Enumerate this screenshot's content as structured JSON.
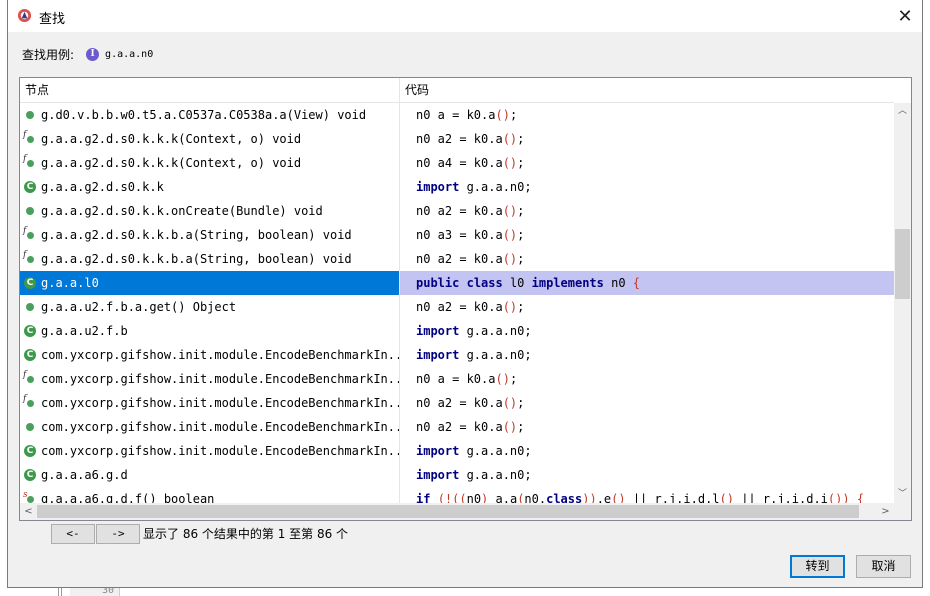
{
  "window": {
    "title": "查找",
    "close_symbol": "✕"
  },
  "search": {
    "label": "查找用例:",
    "badge": "I",
    "value": "g.a.a.n0"
  },
  "table": {
    "headers": {
      "node": "节点",
      "code": "代码"
    },
    "rows": [
      {
        "icon": "method-icon",
        "node": "g.d0.v.b.b.w0.t5.a.C0537a.C0538a.a(View) void",
        "code": [
          [
            "",
            "n0 a = k0.a"
          ],
          [
            "pr",
            "()"
          ],
          [
            "",
            ";"
          ]
        ]
      },
      {
        "icon": "subclass-method-icon",
        "node": "g.a.a.g2.d.s0.k.k.k(Context, o) void",
        "code": [
          [
            "",
            "n0 a2 = k0.a"
          ],
          [
            "pr",
            "()"
          ],
          [
            "",
            ";"
          ]
        ]
      },
      {
        "icon": "subclass-method-icon",
        "node": "g.a.a.g2.d.s0.k.k.k(Context, o) void",
        "code": [
          [
            "",
            "n0 a4 = k0.a"
          ],
          [
            "pr",
            "()"
          ],
          [
            "",
            ";"
          ]
        ]
      },
      {
        "icon": "class-icon",
        "node": "g.a.a.g2.d.s0.k.k",
        "code": [
          [
            "kw",
            "import"
          ],
          [
            "",
            " g.a.a.n0;"
          ]
        ]
      },
      {
        "icon": "method-icon",
        "node": "g.a.a.g2.d.s0.k.k.onCreate(Bundle) void",
        "code": [
          [
            "",
            "n0 a2 = k0.a"
          ],
          [
            "pr",
            "()"
          ],
          [
            "",
            ";"
          ]
        ]
      },
      {
        "icon": "subclass-method-icon",
        "node": "g.a.a.g2.d.s0.k.k.b.a(String, boolean) void",
        "code": [
          [
            "",
            "n0 a3 = k0.a"
          ],
          [
            "pr",
            "()"
          ],
          [
            "",
            ";"
          ]
        ]
      },
      {
        "icon": "subclass-method-icon",
        "node": "g.a.a.g2.d.s0.k.k.b.a(String, boolean) void",
        "code": [
          [
            "",
            "n0 a2 = k0.a"
          ],
          [
            "pr",
            "()"
          ],
          [
            "",
            ";"
          ]
        ]
      },
      {
        "icon": "class-icon",
        "node": "g.a.a.l0",
        "selected": true,
        "code": [
          [
            "kw",
            "public"
          ],
          [
            "",
            " "
          ],
          [
            "kw",
            "class"
          ],
          [
            "",
            " l0 "
          ],
          [
            "kw",
            "implements"
          ],
          [
            "",
            " n0 "
          ],
          [
            "pr",
            "{"
          ]
        ]
      },
      {
        "icon": "method-icon",
        "node": "g.a.a.u2.f.b.a.get() Object",
        "code": [
          [
            "",
            "n0 a2 = k0.a"
          ],
          [
            "pr",
            "()"
          ],
          [
            "",
            ";"
          ]
        ]
      },
      {
        "icon": "class-icon",
        "node": "g.a.a.u2.f.b",
        "code": [
          [
            "kw",
            "import"
          ],
          [
            "",
            " g.a.a.n0;"
          ]
        ]
      },
      {
        "icon": "class-icon",
        "node": "com.yxcorp.gifshow.init.module.EncodeBenchmarkIn...",
        "code": [
          [
            "kw",
            "import"
          ],
          [
            "",
            " g.a.a.n0;"
          ]
        ]
      },
      {
        "icon": "subclass-method-icon",
        "node": "com.yxcorp.gifshow.init.module.EncodeBenchmarkIn...",
        "code": [
          [
            "",
            "n0 a = k0.a"
          ],
          [
            "pr",
            "()"
          ],
          [
            "",
            ";"
          ]
        ]
      },
      {
        "icon": "subclass-method-icon",
        "node": "com.yxcorp.gifshow.init.module.EncodeBenchmarkIn...",
        "code": [
          [
            "",
            "n0 a2 = k0.a"
          ],
          [
            "pr",
            "()"
          ],
          [
            "",
            ";"
          ]
        ]
      },
      {
        "icon": "method-icon",
        "node": "com.yxcorp.gifshow.init.module.EncodeBenchmarkIn...",
        "code": [
          [
            "",
            "n0 a2 = k0.a"
          ],
          [
            "pr",
            "()"
          ],
          [
            "",
            ";"
          ]
        ]
      },
      {
        "icon": "class-icon",
        "node": "com.yxcorp.gifshow.init.module.EncodeBenchmarkIn...",
        "code": [
          [
            "kw",
            "import"
          ],
          [
            "",
            " g.a.a.n0;"
          ]
        ]
      },
      {
        "icon": "class-icon",
        "node": "g.a.a.a6.g.d",
        "code": [
          [
            "kw",
            "import"
          ],
          [
            "",
            " g.a.a.n0;"
          ]
        ]
      },
      {
        "icon": "synthetic-method-icon",
        "node": "g.a.a.a6.g.d.f() boolean",
        "code": [
          [
            "kw",
            "if"
          ],
          [
            "",
            " "
          ],
          [
            "pr",
            "(!(("
          ],
          [
            "",
            "n0"
          ],
          [
            "pr",
            ")"
          ],
          [
            "",
            " a.a"
          ],
          [
            "pr",
            "("
          ],
          [
            "",
            "n0."
          ],
          [
            "kw",
            "class"
          ],
          [
            "pr",
            "))"
          ],
          [
            "",
            ".e"
          ],
          [
            "pr",
            "()"
          ],
          [
            "",
            " || r.j.i.d.l"
          ],
          [
            "pr",
            "()"
          ],
          [
            "",
            " || r.j.i.d.i"
          ],
          [
            "pr",
            "())"
          ],
          [
            "",
            " "
          ],
          [
            "pr",
            "{"
          ]
        ]
      }
    ]
  },
  "scroll_glyphs": {
    "up": "︿",
    "down": "﹀",
    "left": "<",
    "right": ">"
  },
  "pager": {
    "prev_label": "<-",
    "next_label": "->",
    "info": "显示了 86 个结果中的第 1 至第 86 个"
  },
  "buttons": {
    "goto": "转到",
    "cancel": "取消"
  },
  "background": {
    "line_number": "30"
  },
  "colors": {
    "selection": "#0078d7",
    "code_selection": "#c4c4f2",
    "keyword": "#000080",
    "paren": "#c0392b",
    "class_icon": "#3d9a4b"
  }
}
